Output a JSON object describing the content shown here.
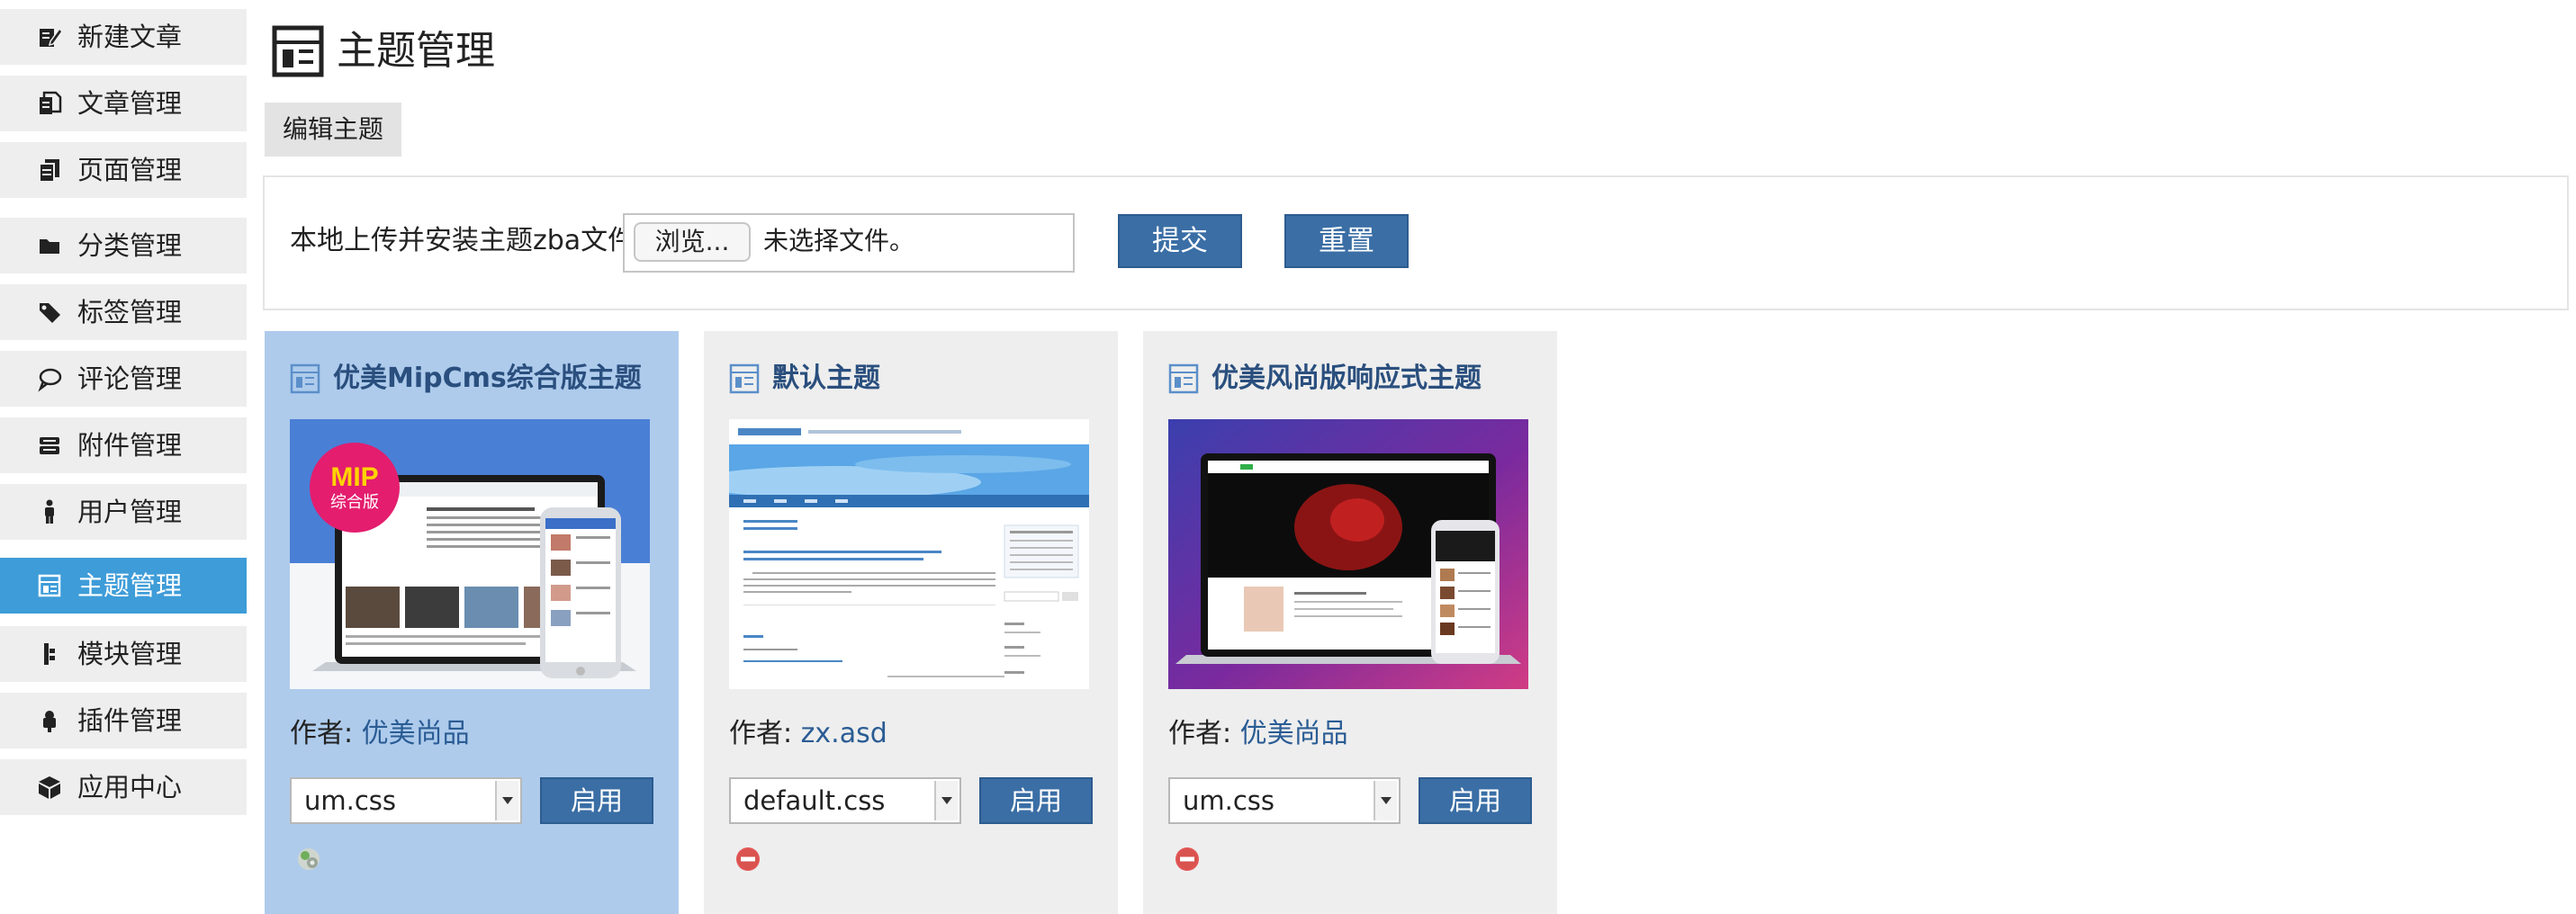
{
  "sidebar": {
    "items": [
      {
        "label": "新建文章",
        "icon": "edit-icon",
        "active": false
      },
      {
        "label": "文章管理",
        "icon": "articles-icon",
        "active": false
      },
      {
        "label": "页面管理",
        "icon": "pages-icon",
        "active": false
      },
      {
        "label": "分类管理",
        "icon": "folder-icon",
        "active": false
      },
      {
        "label": "标签管理",
        "icon": "tag-icon",
        "active": false
      },
      {
        "label": "评论管理",
        "icon": "comment-icon",
        "active": false
      },
      {
        "label": "附件管理",
        "icon": "attachment-icon",
        "active": false
      },
      {
        "label": "用户管理",
        "icon": "user-icon",
        "active": false
      },
      {
        "label": "主题管理",
        "icon": "theme-icon",
        "active": true
      },
      {
        "label": "模块管理",
        "icon": "module-icon",
        "active": false
      },
      {
        "label": "插件管理",
        "icon": "plugin-icon",
        "active": false
      },
      {
        "label": "应用中心",
        "icon": "app-center-icon",
        "active": false
      }
    ]
  },
  "header": {
    "title": "主题管理",
    "tab_label": "编辑主题"
  },
  "upload": {
    "label": "本地上传并安装主题zba文件:",
    "browse_label": "浏览...",
    "no_file_text": "未选择文件。",
    "submit_label": "提交",
    "reset_label": "重置"
  },
  "themes": [
    {
      "name": "优美MipCms综合版主题",
      "author_prefix": "作者: ",
      "author": "优美尚品",
      "style_value": "um.css",
      "enable_label": "启用",
      "current": true,
      "action_icon": "settings-icon",
      "preview_badge": [
        "MIP",
        "综合版"
      ]
    },
    {
      "name": "默认主题",
      "author_prefix": "作者: ",
      "author": "zx.asd",
      "style_value": "default.css",
      "enable_label": "启用",
      "current": false,
      "action_icon": "delete-icon",
      "preview_badge": []
    },
    {
      "name": "优美风尚版响应式主题",
      "author_prefix": "作者: ",
      "author": "优美尚品",
      "style_value": "um.css",
      "enable_label": "启用",
      "current": false,
      "action_icon": "delete-icon",
      "preview_badge": []
    }
  ],
  "colors": {
    "accent": "#3e9cd8",
    "button": "#3a6ea5",
    "current_card": "#aecbec",
    "card": "#eeeeee",
    "title_text": "#2a4f7e"
  }
}
